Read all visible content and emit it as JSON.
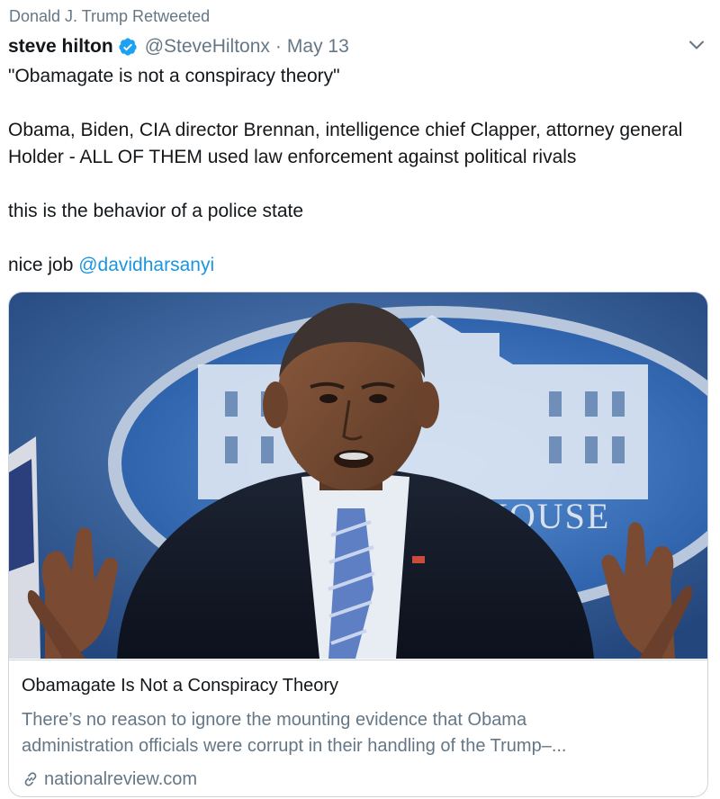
{
  "retweet_context": "Donald J. Trump Retweeted",
  "author": {
    "display_name": "steve hilton",
    "handle": "@SteveHiltonx",
    "verified": true,
    "date": "May 13",
    "separator": "·"
  },
  "tweet": {
    "line1": "\"Obamagate is not a conspiracy theory\"",
    "line2": "Obama, Biden, CIA director Brennan, intelligence chief Clapper, attorney general Holder - ALL OF THEM used law enforcement against political rivals",
    "line3": "this is the behavior of a police state",
    "line4_prefix": "nice job ",
    "line4_mention": "@davidharsanyi"
  },
  "card": {
    "image_icon": "photo-of-man-at-podium",
    "image_sign_text": "HOUSE",
    "title": "Obamagate Is Not a Conspiracy Theory",
    "description_line1": "There’s no reason to ignore the mounting evidence that Obama",
    "description_line2": "administration officials were corrupt in their handling of the Trump–...",
    "domain": "nationalreview.com"
  },
  "colors": {
    "link_blue": "#1b95e0",
    "secondary_text": "#657786",
    "verified_blue": "#1da1f2"
  }
}
